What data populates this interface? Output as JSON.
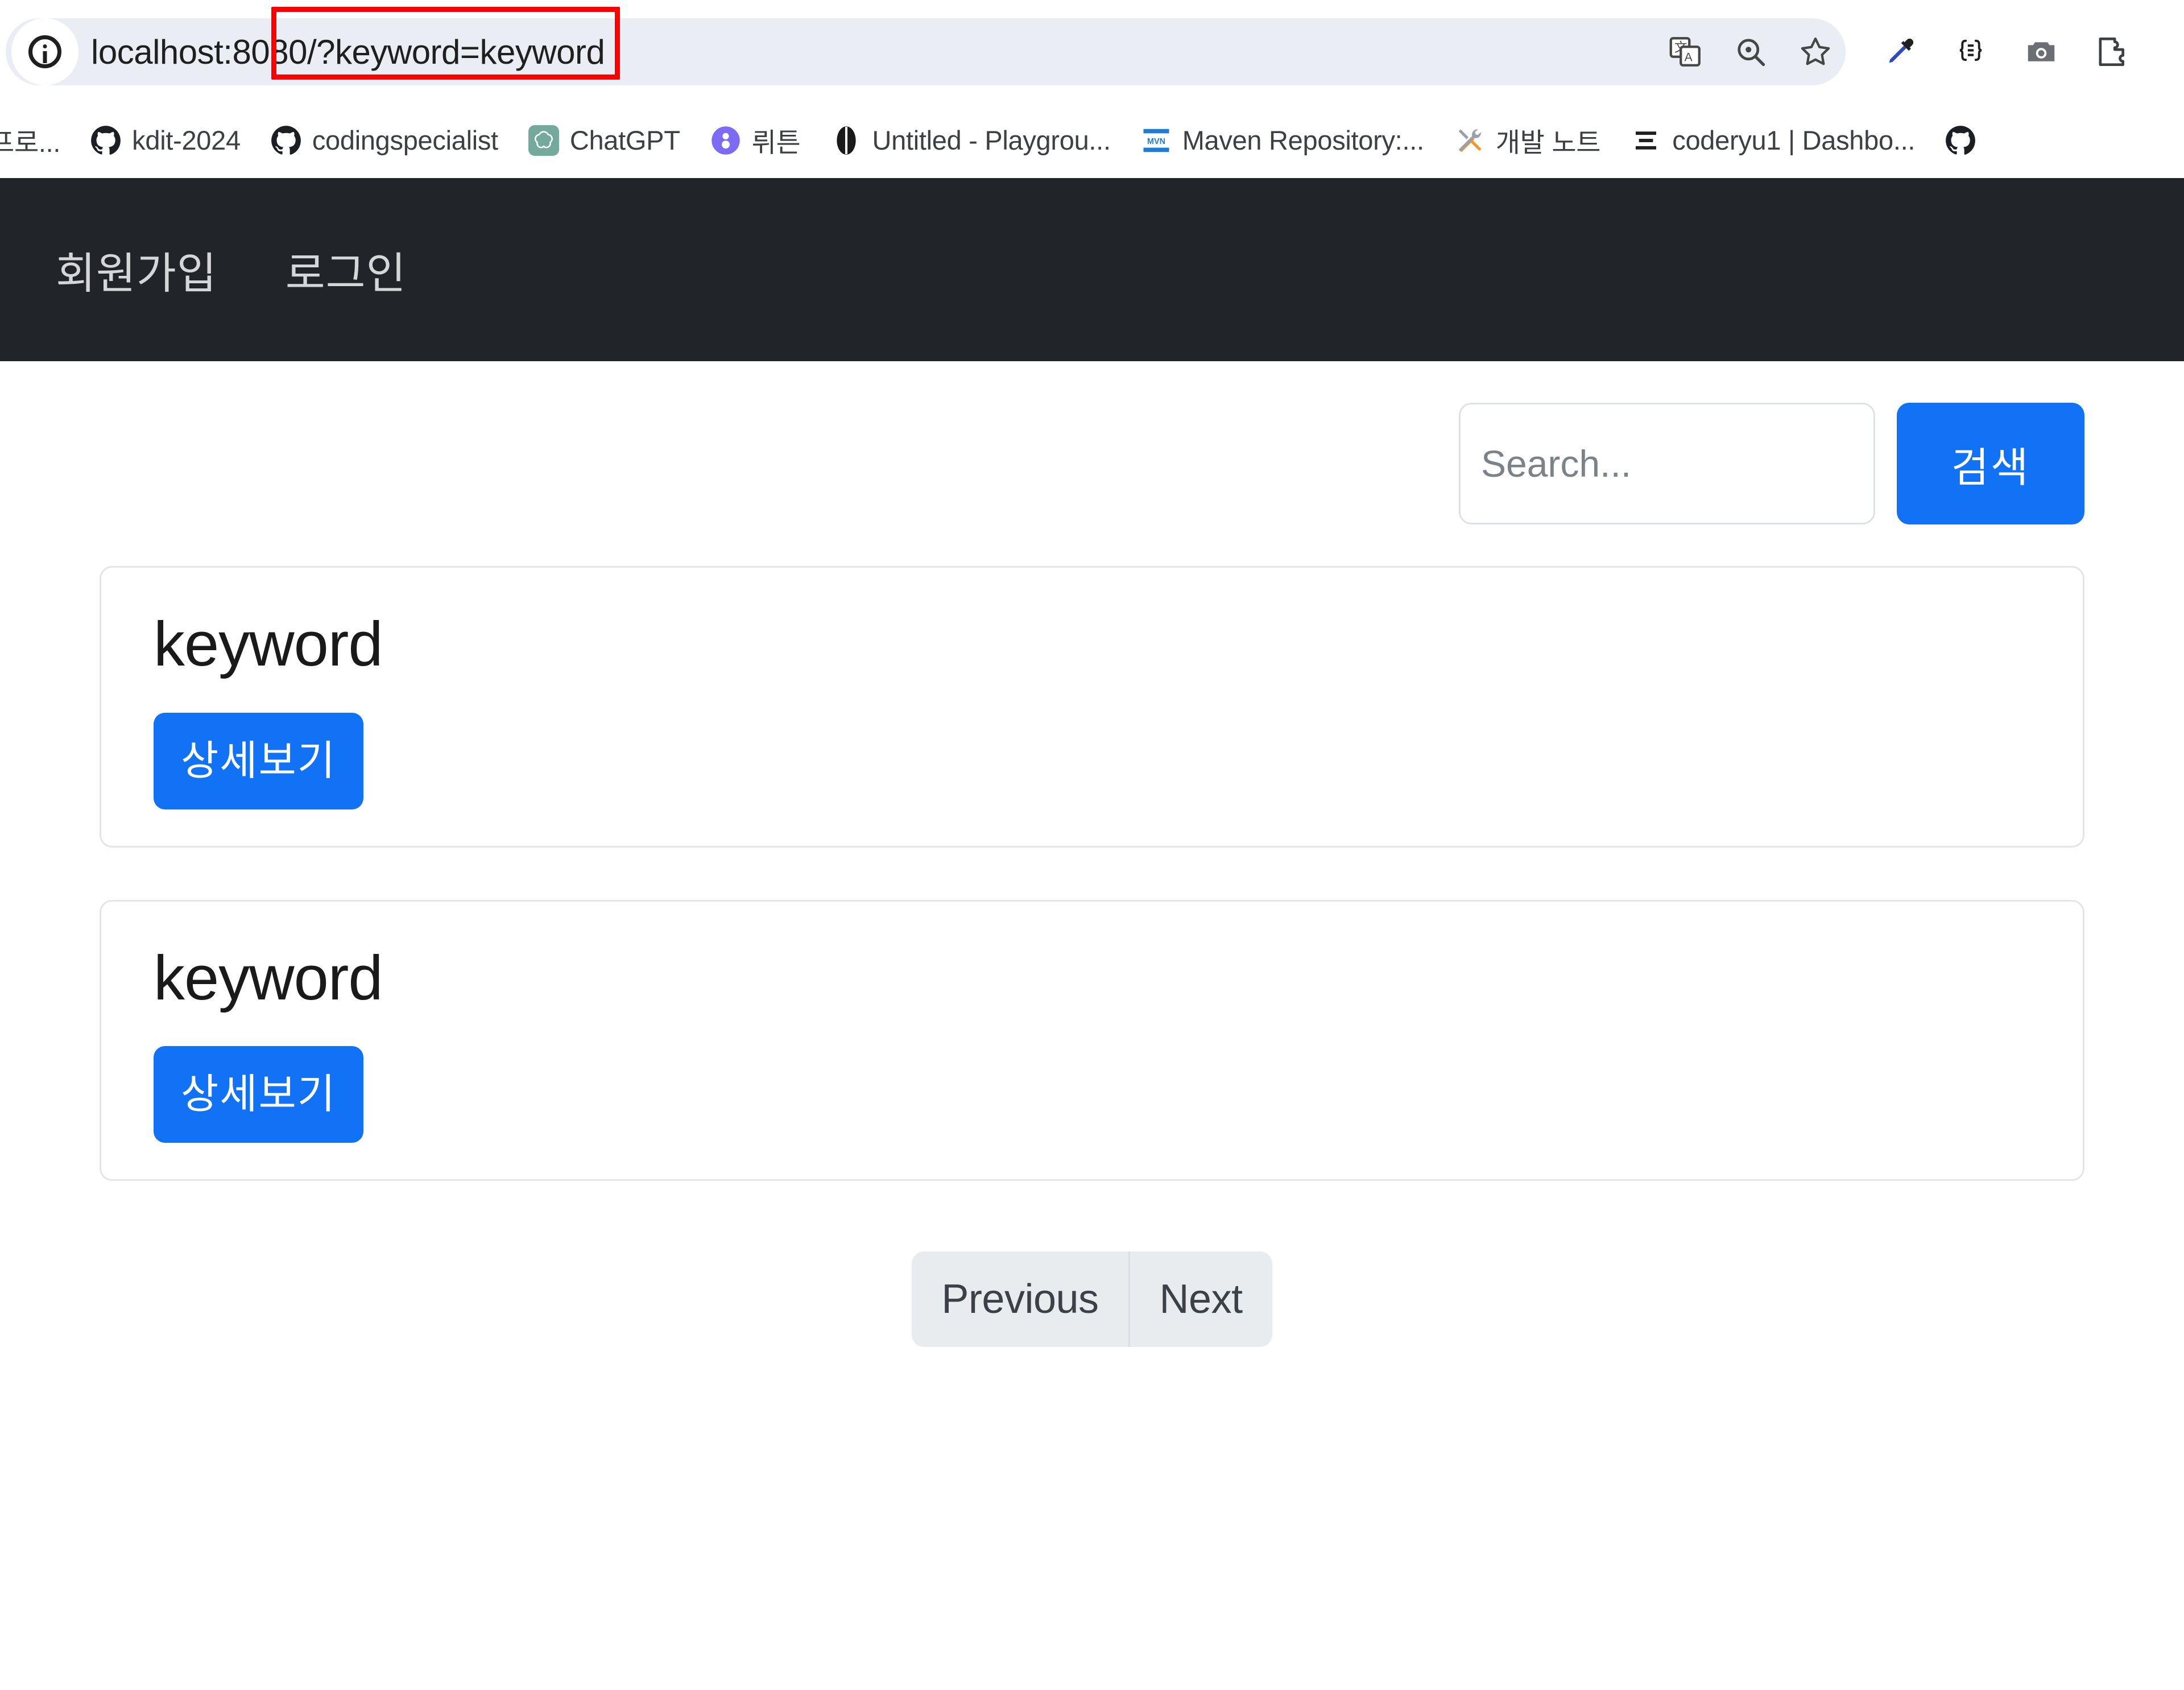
{
  "browser": {
    "omnibox": {
      "site_info_icon": "info-circle-icon",
      "url": "localhost:8080/?keyword=keyword",
      "annotation_color": "#fe0000"
    },
    "omnibox_actions": [
      {
        "name": "translate-icon",
        "label": "Translate this page"
      },
      {
        "name": "search-icon",
        "label": "Search with Google Lens"
      },
      {
        "name": "bookmark-star-icon",
        "label": "Bookmark this tab"
      }
    ],
    "toolbar_actions": [
      {
        "name": "eyedropper-extension-icon",
        "label": "ColorPick Eyedropper"
      },
      {
        "name": "json-braces-extension-icon",
        "label": "JSON Formatter"
      },
      {
        "name": "camera-extension-icon",
        "label": "Screenshot Capture"
      },
      {
        "name": "extensions-puzzle-icon",
        "label": "Extensions"
      }
    ],
    "bookmarks": [
      {
        "label": "프로...",
        "favicon": "generic-page-icon"
      },
      {
        "label": "kdit-2024",
        "favicon": "github-icon"
      },
      {
        "label": "codingspecialist",
        "favicon": "github-icon"
      },
      {
        "label": "ChatGPT",
        "favicon": "chatgpt-icon"
      },
      {
        "label": "뤼튼",
        "favicon": "wrtn-icon"
      },
      {
        "label": "Untitled - Playgrou...",
        "favicon": "anthropic-icon"
      },
      {
        "label": "Maven Repository:...",
        "favicon": "maven-icon"
      },
      {
        "label": "개발 노트",
        "favicon": "tools-icon"
      },
      {
        "label": "coderyu1 | Dashbo...",
        "favicon": "list-icon"
      },
      {
        "label": "",
        "favicon": "github-icon"
      }
    ]
  },
  "site": {
    "navbar": {
      "links": [
        {
          "label": "회원가입"
        },
        {
          "label": "로그인"
        }
      ]
    },
    "search": {
      "placeholder": "Search...",
      "value": "",
      "submit_label": "검색",
      "accent_color": "#1272f5"
    },
    "results": [
      {
        "title": "keyword",
        "detail_label": "상세보기"
      },
      {
        "title": "keyword",
        "detail_label": "상세보기"
      }
    ],
    "pagination": {
      "previous_label": "Previous",
      "next_label": "Next"
    }
  }
}
